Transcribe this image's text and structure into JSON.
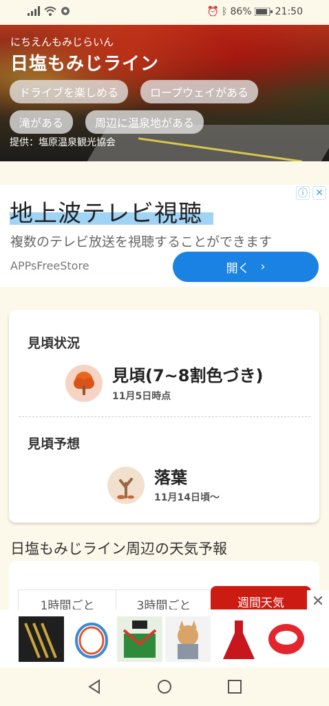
{
  "status_bar": {
    "battery": "86%",
    "time": "21:50"
  },
  "hero": {
    "reading": "にちえんもみじらいん",
    "title": "日塩もみじライン",
    "tags": [
      "ドライブを楽しめる",
      "ロープウェイがある",
      "滝がある",
      "周辺に温泉地がある"
    ],
    "credit": "提供：塩原温泉観光協会"
  },
  "ad": {
    "headline": "地上波テレビ視聴",
    "description": "複数のテレビ放送を視聴することができます",
    "brand": "APPsFreeStore",
    "open_label": "開く",
    "icons": [
      "info-icon",
      "close-icon"
    ]
  },
  "status_card": {
    "current_label": "見頃状況",
    "current_status": "見頃(7~8割色づき)",
    "current_date": "11月5日時点",
    "forecast_label": "見頃予想",
    "forecast_status": "落葉",
    "forecast_date": "11月14日頃〜",
    "current_icon": "autumn-tree-icon",
    "forecast_icon": "bare-tree-icon"
  },
  "weather": {
    "title": "日塩もみじライン周辺の天気予報",
    "tabs": [
      "1時間ごと",
      "3時間ごと",
      "週間天気"
    ],
    "active_tab": "週間天気"
  },
  "colors": {
    "accent": "#cc1b12",
    "ad_button": "#1a82e2",
    "background": "#fdf9ea"
  }
}
